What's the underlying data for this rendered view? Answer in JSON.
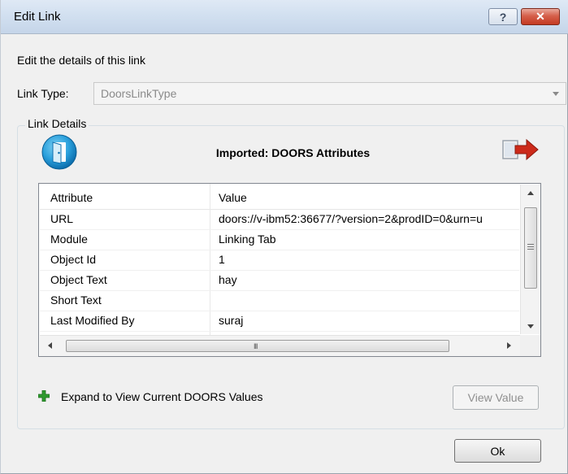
{
  "window": {
    "title": "Edit Link",
    "help_glyph": "?",
    "close_glyph": "✕"
  },
  "description": "Edit the details of this link",
  "link_type": {
    "label": "Link Type:",
    "value": "DoorsLinkType"
  },
  "link_details": {
    "legend": "Link Details",
    "title": "Imported: DOORS Attributes",
    "icons": [
      "door-icon",
      "exit-arrow-icon"
    ]
  },
  "grid": {
    "columns": [
      "Attribute",
      "Value"
    ],
    "rows": [
      {
        "attribute": "URL",
        "value": "doors://v-ibm52:36677/?version=2&prodID=0&urn=u"
      },
      {
        "attribute": "Module",
        "value": "Linking Tab"
      },
      {
        "attribute": "Object Id",
        "value": "1"
      },
      {
        "attribute": "Object Text",
        "value": "hay"
      },
      {
        "attribute": "Short Text",
        "value": ""
      },
      {
        "attribute": "Last Modified By",
        "value": "suraj"
      }
    ],
    "h_scroll_grip": "III"
  },
  "expand": {
    "label": "Expand to View Current DOORS Values",
    "icon": "plus-icon",
    "color": "#2e9a2e"
  },
  "buttons": {
    "view_value": "View Value",
    "ok": "Ok"
  }
}
